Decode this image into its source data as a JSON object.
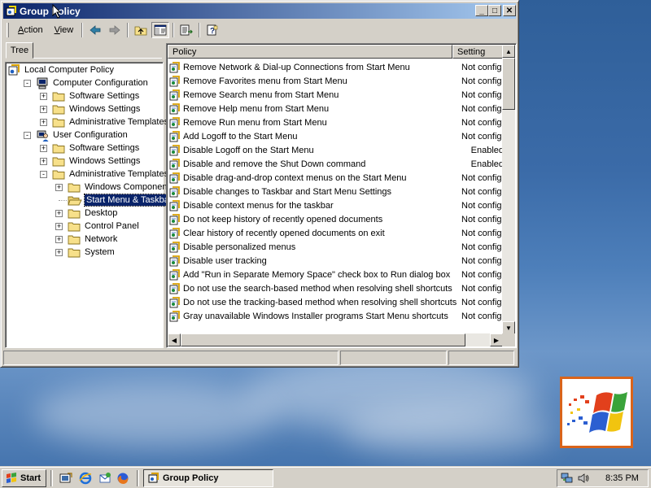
{
  "window": {
    "title": "Group Policy",
    "minimize_label": "_",
    "maximize_label": "□",
    "close_label": "✕"
  },
  "menubar": {
    "items": [
      {
        "label": "Action",
        "underline": "A"
      },
      {
        "label": "View",
        "underline": "V"
      }
    ]
  },
  "tree": {
    "tab_label": "Tree",
    "nodes": [
      {
        "label": "Local Computer Policy",
        "level": 0,
        "icon": "computer-policy-icon",
        "expander": "",
        "selected": false
      },
      {
        "label": "Computer Configuration",
        "level": 1,
        "icon": "computer-icon",
        "expander": "-",
        "selected": false
      },
      {
        "label": "Software Settings",
        "level": 2,
        "icon": "folder-icon",
        "expander": "+",
        "selected": false
      },
      {
        "label": "Windows Settings",
        "level": 2,
        "icon": "folder-icon",
        "expander": "+",
        "selected": false
      },
      {
        "label": "Administrative Templates",
        "level": 2,
        "icon": "folder-icon",
        "expander": "+",
        "selected": false
      },
      {
        "label": "User Configuration",
        "level": 1,
        "icon": "user-icon",
        "expander": "-",
        "selected": false
      },
      {
        "label": "Software Settings",
        "level": 2,
        "icon": "folder-icon",
        "expander": "+",
        "selected": false
      },
      {
        "label": "Windows Settings",
        "level": 2,
        "icon": "folder-icon",
        "expander": "+",
        "selected": false
      },
      {
        "label": "Administrative Templates",
        "level": 2,
        "icon": "folder-icon",
        "expander": "-",
        "selected": false
      },
      {
        "label": "Windows Components",
        "level": 3,
        "icon": "folder-icon",
        "expander": "+",
        "selected": false
      },
      {
        "label": "Start Menu & Taskbar",
        "level": 3,
        "icon": "folder-open-icon",
        "expander": "",
        "selected": true
      },
      {
        "label": "Desktop",
        "level": 3,
        "icon": "folder-icon",
        "expander": "+",
        "selected": false
      },
      {
        "label": "Control Panel",
        "level": 3,
        "icon": "folder-icon",
        "expander": "+",
        "selected": false
      },
      {
        "label": "Network",
        "level": 3,
        "icon": "folder-icon",
        "expander": "+",
        "selected": false
      },
      {
        "label": "System",
        "level": 3,
        "icon": "folder-icon",
        "expander": "+",
        "selected": false
      }
    ]
  },
  "list": {
    "columns": [
      "Policy",
      "Setting"
    ],
    "rows": [
      {
        "policy": "Remove Network & Dial-up Connections from Start Menu",
        "setting": "Not configured"
      },
      {
        "policy": "Remove Favorites menu from Start Menu",
        "setting": "Not configured"
      },
      {
        "policy": "Remove Search menu from Start Menu",
        "setting": "Not configured"
      },
      {
        "policy": "Remove Help menu from Start Menu",
        "setting": "Not configured"
      },
      {
        "policy": "Remove Run menu from Start Menu",
        "setting": "Not configured"
      },
      {
        "policy": "Add Logoff to the Start Menu",
        "setting": "Not configured"
      },
      {
        "policy": "Disable Logoff on the Start Menu",
        "setting": "Enabled"
      },
      {
        "policy": "Disable and remove the Shut Down command",
        "setting": "Enabled"
      },
      {
        "policy": "Disable drag-and-drop context menus on the Start Menu",
        "setting": "Not configured"
      },
      {
        "policy": "Disable changes to Taskbar and Start Menu Settings",
        "setting": "Not configured"
      },
      {
        "policy": "Disable context menus for the taskbar",
        "setting": "Not configured"
      },
      {
        "policy": "Do not keep history of recently opened documents",
        "setting": "Not configured"
      },
      {
        "policy": "Clear history of recently opened documents on exit",
        "setting": "Not configured"
      },
      {
        "policy": "Disable personalized menus",
        "setting": "Not configured"
      },
      {
        "policy": "Disable user tracking",
        "setting": "Not configured"
      },
      {
        "policy": "Add \"Run in Separate Memory Space\" check box to Run dialog box",
        "setting": "Not configured"
      },
      {
        "policy": "Do not use the search-based method when resolving shell shortcuts",
        "setting": "Not configured"
      },
      {
        "policy": "Do not use the tracking-based method when resolving shell shortcuts",
        "setting": "Not configured"
      },
      {
        "policy": "Gray unavailable Windows Installer programs Start Menu shortcuts",
        "setting": "Not configured"
      }
    ]
  },
  "taskbar": {
    "start_label": "Start",
    "task_label": "Group Policy",
    "clock": "8:35 PM"
  },
  "colors": {
    "title_active": "#0a246a",
    "selection": "#0a246a",
    "face": "#d4d0c8",
    "logo_border": "#d9641b"
  }
}
